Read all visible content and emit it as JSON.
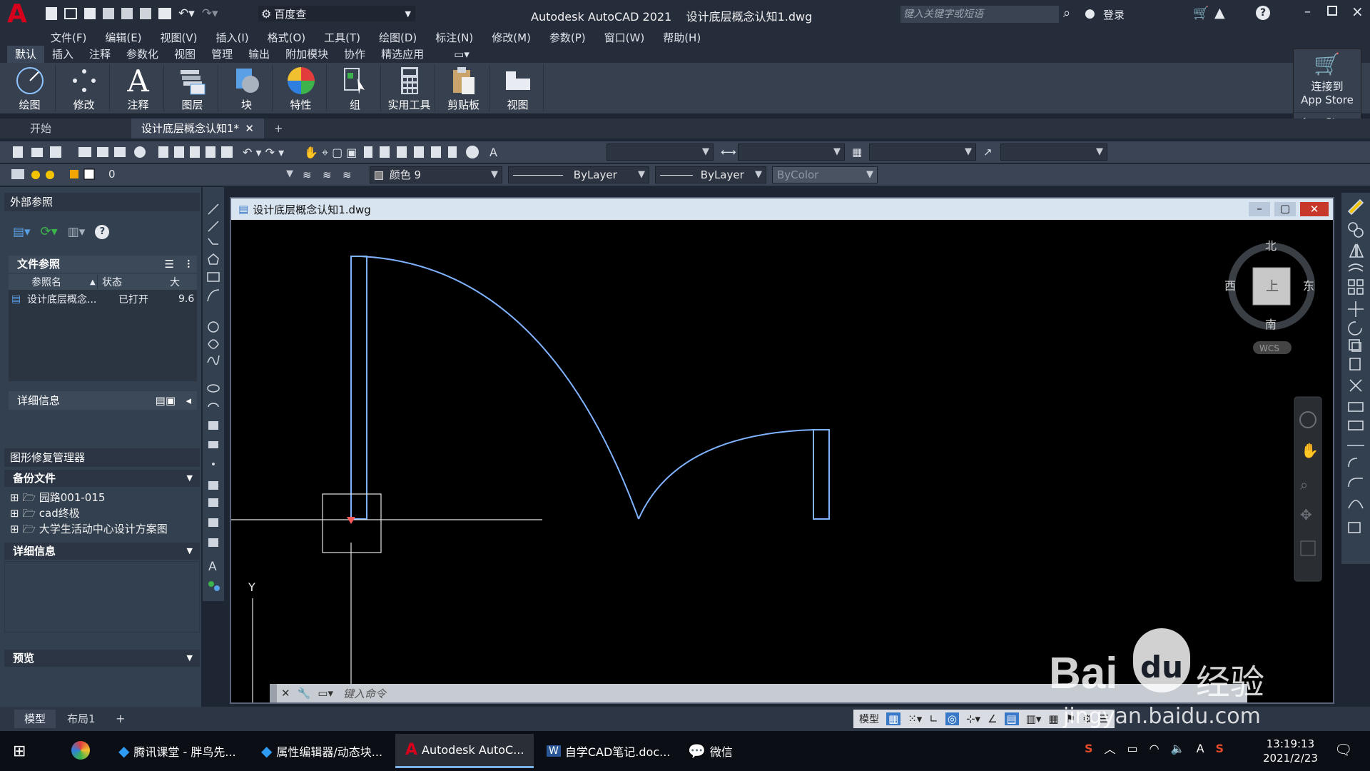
{
  "app": {
    "logo": "A",
    "title": "Autodesk AutoCAD 2021",
    "filename": "设计底层概念认知1.dwg",
    "workspace": "百度查",
    "search_placeholder": "键入关键字或短语",
    "login": "登录"
  },
  "menus": [
    "文件(F)",
    "编辑(E)",
    "视图(V)",
    "插入(I)",
    "格式(O)",
    "工具(T)",
    "绘图(D)",
    "标注(N)",
    "修改(M)",
    "参数(P)",
    "窗口(W)",
    "帮助(H)"
  ],
  "ribbon_tabs": [
    "默认",
    "插入",
    "注释",
    "参数化",
    "视图",
    "管理",
    "输出",
    "附加模块",
    "协作",
    "精选应用"
  ],
  "ribbon_groups": [
    "绘图",
    "修改",
    "注释",
    "图层",
    "块",
    "特性",
    "组",
    "实用工具",
    "剪贴板",
    "视图"
  ],
  "appstore": {
    "label1": "连接到",
    "label2": "App Store",
    "footer": "App Store"
  },
  "doc_tabs": {
    "start": "开始",
    "active": "设计底层概念认知1*"
  },
  "toolbar2": {
    "layer": "0",
    "color": "颜色 9",
    "linetype": "ByLayer",
    "lineweight": "ByLayer",
    "plotstyle": "ByColor"
  },
  "xref_panel": {
    "title": "外部参照",
    "file_refs": "文件参照",
    "col_name": "参照名",
    "col_status": "状态",
    "col_size": "大",
    "row_name": "设计底层概念...",
    "row_status": "已打开",
    "row_size": "9.6",
    "details": "详细信息"
  },
  "recovery_panel": {
    "title": "图形修复管理器",
    "backup": "备份文件",
    "items": [
      "园路001-015",
      "cad终极",
      "大学生活动中心设计方案图"
    ],
    "details": "详细信息",
    "preview": "预览"
  },
  "drawing": {
    "title": "设计底层概念认知1.dwg",
    "compass": {
      "n": "北",
      "s": "南",
      "e": "东",
      "w": "西",
      "top": "上"
    },
    "wcs": "WCS",
    "ucs_y": "Y",
    "command_placeholder": "键入命令"
  },
  "status": {
    "model_tab": "模型",
    "layout_tab": "布局1",
    "plus": "+",
    "model_btn": "模型"
  },
  "taskbar": {
    "items": [
      "腾讯课堂 - 胖鸟先...",
      "属性编辑器/动态块...",
      "Autodesk AutoC...",
      "自学CAD笔记.doc...",
      "微信"
    ],
    "time": "13:19:13",
    "date": "2021/2/23",
    "ime": "A"
  },
  "watermark": {
    "brand": "Bai",
    "paw": "du",
    "cn": "经验",
    "url": "jingyan.baidu.com"
  },
  "colors": {
    "accent": "#d6001c",
    "line": "#7fb2ff",
    "bg": "#000000"
  }
}
